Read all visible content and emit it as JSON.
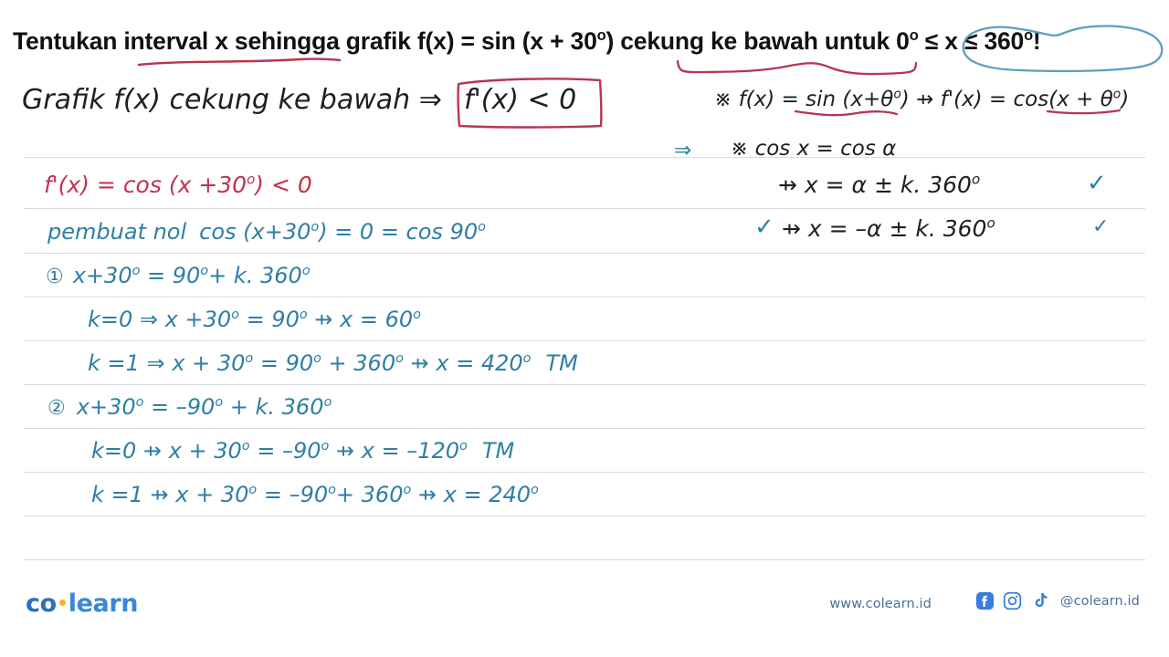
{
  "question": {
    "prefix": "Tentukan interval x sehingga grafik f(x) = sin (x + 30",
    "deg1": "o",
    "mid": ") cekung ke bawah untuk ",
    "range": "0",
    "deg2": "o",
    "range_mid": " ≤ x ≤ 360",
    "deg3": "o",
    "suffix": "!",
    "full_text": "Tentukan interval x sehingga grafik f(x) = sin (x + 30°) cekung ke bawah untuk 0° ≤ x ≤ 360°!"
  },
  "annotations": {
    "underline_interval": "red-underline-interval-x",
    "underline_cekung": "red-squiggle-cekung-ke-bawah",
    "circle_range": "blue-circle-0-to-360",
    "box_derivative": "red-box-f-prime-less-than-zero",
    "underline_sin": "red-underline-sin",
    "underline_cos": "red-underline-cos",
    "arrow_teal": "teal-arrow-implies"
  },
  "left_column": {
    "line_premise": "Grafik f(x) cekung ke bawah ⇒",
    "line_premise_boxed": "f'(x) < 0",
    "line1": {
      "text": "f'(x) = cos (x +30",
      "deg": "o",
      "tail": ") < 0",
      "color": "#c0334f"
    },
    "line2": {
      "label": "pembuat nol",
      "expr": "cos (x+30",
      "deg": "o",
      "tail": ") = 0 = cos 90",
      "deg2": "o",
      "color": "#2f7fa4"
    },
    "line3": {
      "marker": "①",
      "text": "x+30",
      "deg": "o",
      "tail": " = 90",
      "deg2": "o",
      "tail2": "+ k. 360",
      "deg3": "o"
    },
    "line4": {
      "text": "k=0  ⇒ x +30",
      "deg": "o",
      "tail": " = 90",
      "deg2": "o",
      "tail2": " ⇸ x = 60",
      "deg3": "o"
    },
    "line5": {
      "text": "k =1   ⇒ x + 30",
      "deg": "o",
      "tail": " = 90",
      "deg2": "o",
      "tail2": " + 360",
      "deg3": "o",
      "tail3": " ⇸ x = 420",
      "deg4": "o",
      "note": "TM"
    },
    "line6": {
      "marker": "②",
      "text": "x+30",
      "deg": "o",
      "tail": " = –90",
      "deg2": "o",
      "tail2": " + k. 360",
      "deg3": "o"
    },
    "line7": {
      "text": "k=0 ⇸ x + 30",
      "deg": "o",
      "tail": " = –90",
      "deg2": "o",
      "tail2": "  ⇸ x = –120",
      "deg3": "o",
      "note": "TM"
    },
    "line8": {
      "text": "k =1 ⇸ x + 30",
      "deg": "o",
      "tail": " = –90",
      "deg2": "o",
      "tail2": "+ 360",
      "deg3": "o",
      "tail3": " ⇸ x = 240",
      "deg4": "o"
    }
  },
  "right_column": {
    "line1": {
      "text": "※ f(x) = sin (x+θ",
      "deg": "o",
      "tail": ") ⇸ f'(x) = cos(x + θ",
      "deg2": "o",
      "tail2": ")"
    },
    "line2": {
      "arrow": "⇒",
      "text": "※   cos x  =  cos α"
    },
    "line3": {
      "text": "⇸  x  =  α  ±  k. 360",
      "deg": "o",
      "check": "✓"
    },
    "line4": {
      "check_lead": "✓",
      "text": "⇸  x = –α ± k. 360",
      "deg": "o",
      "check": "✓"
    }
  },
  "footer": {
    "logo_co": "co",
    "logo_learn": "learn",
    "website": "www.colearn.id",
    "handle": "@colearn.id",
    "icons": [
      "facebook-icon",
      "instagram-icon",
      "tiktok-icon"
    ]
  },
  "colors": {
    "red_ink": "#c0334f",
    "teal_ink": "#2f7fa4",
    "dark_ink": "#1d1f22",
    "rule_line": "#d9dcdf",
    "brand_blue": "#2b6fc4",
    "brand_gold": "#f2b02e",
    "facebook_blue": "#3b7de0"
  }
}
